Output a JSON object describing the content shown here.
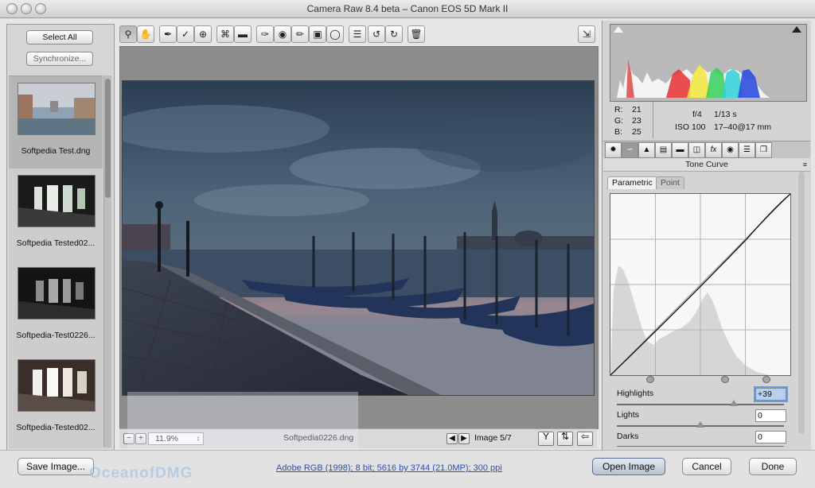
{
  "window": {
    "title": "Camera Raw 8.4 beta  –  Canon EOS 5D Mark II"
  },
  "left_panel": {
    "select_all_label": "Select All",
    "synchronize_label": "Synchronize...",
    "thumbnails": [
      {
        "label": "Softpedia Test.dng",
        "selected": true
      },
      {
        "label": "Softpedia Tested02...",
        "selected": false
      },
      {
        "label": "Softpedia-Test0226...",
        "selected": false
      },
      {
        "label": "Softpedia-Tested02...",
        "selected": false
      }
    ]
  },
  "toolbar": {
    "tools": [
      {
        "icon": "zoom-icon",
        "active": true
      },
      {
        "icon": "hand-icon",
        "active": false
      },
      {
        "icon": "white-balance-icon",
        "active": false
      },
      {
        "icon": "color-sampler-icon",
        "active": false
      },
      {
        "icon": "targeted-adjust-icon",
        "active": false
      },
      {
        "icon": "crop-icon",
        "active": false
      },
      {
        "icon": "straighten-icon",
        "active": false
      },
      {
        "icon": "spot-removal-icon",
        "active": false
      },
      {
        "icon": "red-eye-icon",
        "active": false
      },
      {
        "icon": "adjustment-brush-icon",
        "active": false
      },
      {
        "icon": "graduated-filter-icon",
        "active": false
      },
      {
        "icon": "radial-filter-icon",
        "active": false
      },
      {
        "icon": "preferences-icon",
        "active": false
      },
      {
        "icon": "rotate-left-icon",
        "active": false
      },
      {
        "icon": "rotate-right-icon",
        "active": false
      },
      {
        "icon": "trash-icon",
        "active": false
      }
    ],
    "fullscreen_icon": "fullscreen-icon"
  },
  "preview": {
    "zoom_out_label": "−",
    "zoom_in_label": "+",
    "zoom_level": "11.9%",
    "filename": "Softpedia0226.dng",
    "image_counter": "Image 5/7"
  },
  "info": {
    "r_label": "R:",
    "r_value": "21",
    "g_label": "G:",
    "g_value": "23",
    "b_label": "B:",
    "b_value": "25",
    "aperture": "f/4",
    "shutter": "1/13 s",
    "iso": "ISO 100",
    "lens": "17–40@17 mm"
  },
  "adjust_panel": {
    "section_title": "Tone Curve",
    "subtabs": [
      "Parametric",
      "Point"
    ],
    "active_subtab": "Parametric",
    "sliders": [
      {
        "name": "Highlights",
        "value": "+39",
        "level": 0.7,
        "selected": true
      },
      {
        "name": "Lights",
        "value": "0",
        "level": 0.5,
        "selected": false
      },
      {
        "name": "Darks",
        "value": "0",
        "level": 0.5,
        "selected": false
      }
    ]
  },
  "bottom": {
    "save_label": "Save Image...",
    "workflow_link": "Adobe RGB (1998); 8 bit; 5616 by 3744 (21.0MP); 300 ppi",
    "open_label": "Open Image",
    "cancel_label": "Cancel",
    "done_label": "Done",
    "watermark_text": "OceanofDMG"
  },
  "colors": {
    "sky": "#4e6578",
    "water": "#3d4d63",
    "boat": "#2b3f66",
    "accent_default_button": "#b8c2d2"
  }
}
